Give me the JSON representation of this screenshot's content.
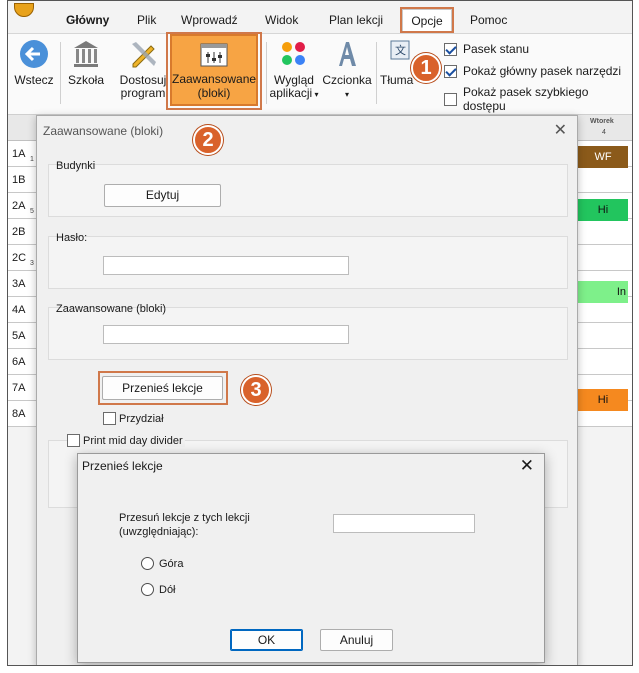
{
  "tabs": [
    "Główny",
    "Plik",
    "Wprowadź",
    "Widok",
    "Plan lekcji",
    "Opcje",
    "Pomoc"
  ],
  "ribbon": {
    "back": "Wstecz",
    "school": "Szkoła",
    "customize_1": "Dostosuj",
    "customize_2": "program",
    "advanced_1": "Zaawansowane",
    "advanced_2": "(bloki)",
    "appearance_1": "Wygląd",
    "appearance_2": "aplikacji",
    "font": "Czcionka",
    "translate": "Tłuma",
    "checks": [
      {
        "label": "Pasek stanu",
        "checked": true
      },
      {
        "label": "Pokaż główny pasek narzędzi",
        "checked": true
      },
      {
        "label": "Pokaż pasek szybkiego dostępu",
        "checked": false
      }
    ]
  },
  "badges": [
    "1",
    "2",
    "3"
  ],
  "grid": {
    "rows": [
      "1A",
      "1B",
      "2A",
      "2B",
      "2C",
      "3A",
      "4A",
      "5A",
      "6A",
      "7A",
      "8A"
    ],
    "subs": [
      "1",
      "",
      "5",
      "",
      "3",
      "",
      "",
      "",
      "",
      "",
      ""
    ],
    "day": "Wtorek",
    "period": "4",
    "cells": [
      {
        "text": "WF",
        "color": "#8b5a1a"
      },
      {
        "text": "Hi",
        "color": "#22c55e"
      },
      {
        "text": "In",
        "color": "#7ef08a"
      },
      {
        "text": "Hi",
        "color": "#f5891f"
      }
    ]
  },
  "advanced_dialog": {
    "title": "Zaawansowane (bloki)",
    "close": "✕",
    "buildings_label": "Budynki",
    "edit_button": "Edytuj",
    "password_label": "Hasło:",
    "advanced_label": "Zaawansowane (bloki)",
    "move_button": "Przenieś lekcje",
    "assign_label": "Przydział",
    "divider_label": "Print mid day divider"
  },
  "move_dialog": {
    "title": "Przenieś lekcje",
    "close": "✕",
    "prompt_1": "Przesuń lekcje z tych lekcji",
    "prompt_2": "(uwzględniając):",
    "options": [
      "Góra",
      "Dół"
    ],
    "ok": "OK",
    "cancel": "Anuluj"
  },
  "colors": {
    "accent": "#f7a444",
    "badge": "#d9622b",
    "check": "#1a4fa0"
  }
}
